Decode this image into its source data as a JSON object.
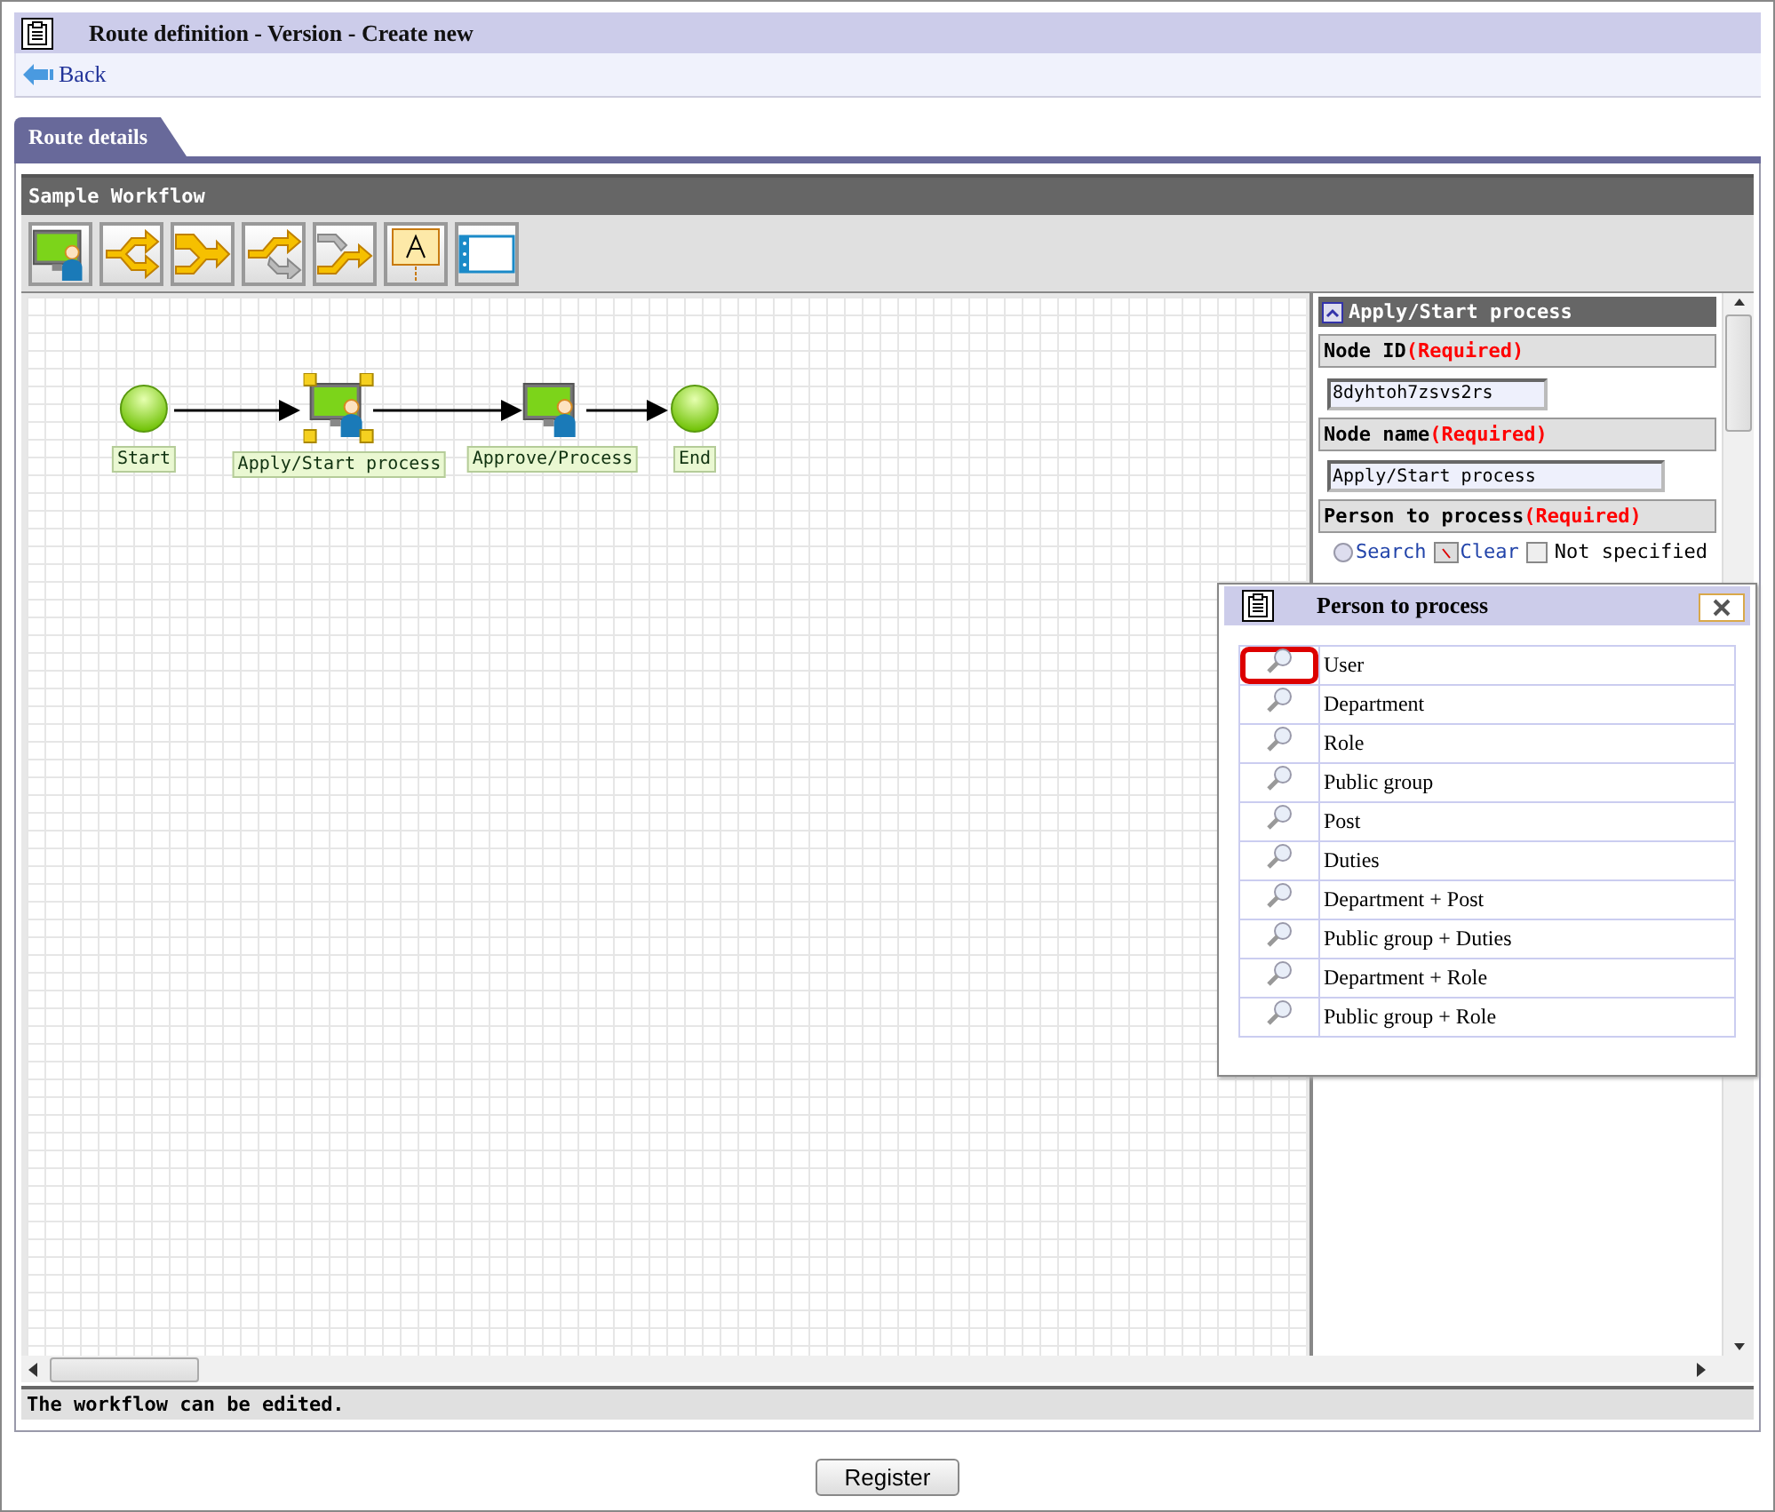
{
  "window": {
    "title": "Route definition - Version - Create new"
  },
  "back_link": "Back",
  "tabs": [
    {
      "label": "Route details",
      "selected": true
    }
  ],
  "workflow": {
    "title": "Sample Workflow",
    "nodes": [
      {
        "kind": "start",
        "label": "Start",
        "selected": false
      },
      {
        "kind": "task",
        "label": "Apply/Start process",
        "selected": true
      },
      {
        "kind": "task",
        "label": "Approve/Process",
        "selected": false
      },
      {
        "kind": "end",
        "label": "End",
        "selected": false
      }
    ],
    "status": "The workflow can be edited."
  },
  "properties": {
    "title": "Apply/Start process",
    "sections": [
      {
        "kind": "input",
        "label": "Node ID",
        "required": "(Required)",
        "value": "8dyhtoh7zsvs2rs"
      },
      {
        "kind": "input",
        "label": "Node name",
        "required": "(Required)",
        "value": "Apply/Start process"
      },
      {
        "kind": "options",
        "label": "Person to process",
        "required": "(Required)",
        "search": "Search",
        "clear": "Clear",
        "not_specified": {
          "label": "Not specified",
          "checked": false
        }
      }
    ]
  },
  "dialog": {
    "title": "Person to process",
    "items": [
      {
        "label": "User",
        "selected": true
      },
      {
        "label": "Department",
        "selected": false
      },
      {
        "label": "Role",
        "selected": false
      },
      {
        "label": "Public group",
        "selected": false
      },
      {
        "label": "Post",
        "selected": false
      },
      {
        "label": "Duties",
        "selected": false
      },
      {
        "label": "Department + Post",
        "selected": false
      },
      {
        "label": "Public group + Duties",
        "selected": false
      },
      {
        "label": "Department + Role",
        "selected": false
      },
      {
        "label": "Public group + Role",
        "selected": false
      }
    ]
  },
  "register_button": "Register"
}
